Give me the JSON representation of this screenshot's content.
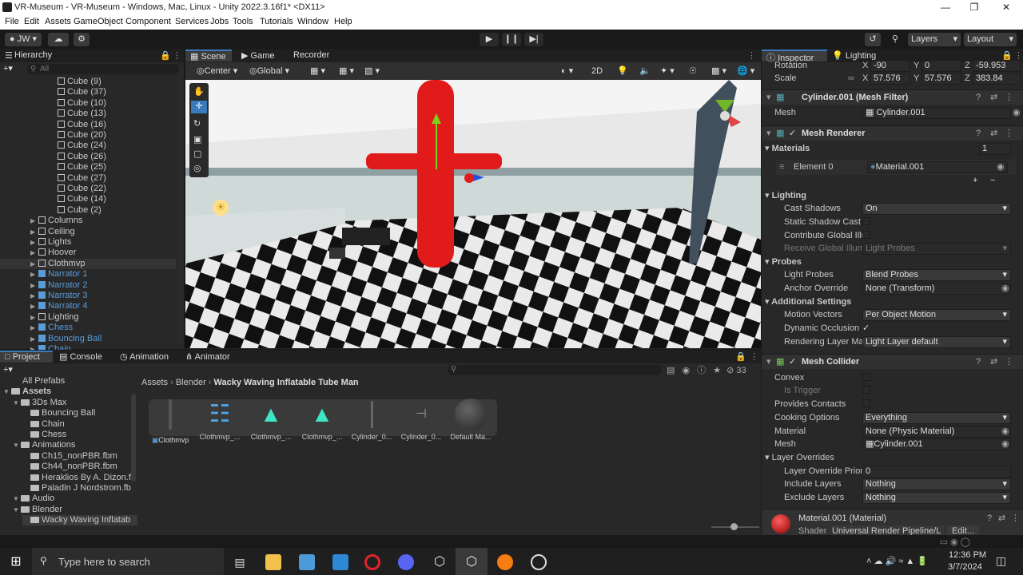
{
  "window": {
    "title": "VR-Museum - VR-Museum - Windows, Mac, Linux - Unity 2022.3.16f1* <DX11>"
  },
  "menu": [
    "File",
    "Edit",
    "Assets",
    "GameObject",
    "Component",
    "Services",
    "Jobs",
    "Tools",
    "Tutorials",
    "Window",
    "Help"
  ],
  "toolbar": {
    "account": "JW",
    "layers": "Layers",
    "layout": "Layout"
  },
  "hierarchy": {
    "tab": "Hierarchy",
    "search_placeholder": "All",
    "items": [
      {
        "label": "Cube (9)",
        "type": "cube"
      },
      {
        "label": "Cube (37)",
        "type": "cube"
      },
      {
        "label": "Cube (10)",
        "type": "cube"
      },
      {
        "label": "Cube (13)",
        "type": "cube"
      },
      {
        "label": "Cube (16)",
        "type": "cube"
      },
      {
        "label": "Cube (20)",
        "type": "cube"
      },
      {
        "label": "Cube (24)",
        "type": "cube"
      },
      {
        "label": "Cube (26)",
        "type": "cube"
      },
      {
        "label": "Cube (25)",
        "type": "cube"
      },
      {
        "label": "Cube (27)",
        "type": "cube"
      },
      {
        "label": "Cube (22)",
        "type": "cube"
      },
      {
        "label": "Cube (14)",
        "type": "cube"
      },
      {
        "label": "Cube (2)",
        "type": "cube"
      },
      {
        "label": "Columns",
        "type": "object"
      },
      {
        "label": "Ceiling",
        "type": "object"
      },
      {
        "label": "Lights",
        "type": "object"
      },
      {
        "label": "Hoover",
        "type": "object"
      },
      {
        "label": "Clothmvp",
        "type": "object"
      },
      {
        "label": "Narrator 1",
        "type": "prefab"
      },
      {
        "label": "Narrator 2",
        "type": "prefab"
      },
      {
        "label": "Narrator 3",
        "type": "prefab"
      },
      {
        "label": "Narrator 4",
        "type": "prefab"
      },
      {
        "label": "Lighting",
        "type": "object"
      },
      {
        "label": "Chess",
        "type": "prefab"
      },
      {
        "label": "Bouncing Ball",
        "type": "prefab"
      },
      {
        "label": "Chain",
        "type": "prefab"
      }
    ]
  },
  "scene": {
    "tabs": [
      "Scene",
      "Game",
      "Recorder"
    ],
    "pivot": "Center",
    "space": "Global",
    "mode_2d": "2D"
  },
  "project": {
    "tabs": [
      "Project",
      "Console",
      "Animation",
      "Animator"
    ],
    "count": "33",
    "breadcrumb": [
      "Assets",
      "Blender",
      "Wacky Waving Inflatable Tube Man"
    ],
    "tree": [
      {
        "label": "All Prefabs",
        "indent": 0
      },
      {
        "label": "Assets",
        "indent": 0
      },
      {
        "label": "3Ds Max",
        "indent": 1
      },
      {
        "label": "Bouncing Ball",
        "indent": 2
      },
      {
        "label": "Chain",
        "indent": 2
      },
      {
        "label": "Chess",
        "indent": 2
      },
      {
        "label": "Animations",
        "indent": 1
      },
      {
        "label": "Ch15_nonPBR.fbm",
        "indent": 2
      },
      {
        "label": "Ch44_nonPBR.fbm",
        "indent": 2
      },
      {
        "label": "Heraklios By A. Dizon.f",
        "indent": 2
      },
      {
        "label": "Paladin J Nordstrom.fb",
        "indent": 2
      },
      {
        "label": "Audio",
        "indent": 1
      },
      {
        "label": "Blender",
        "indent": 1
      },
      {
        "label": "Wacky Waving Inflatab",
        "indent": 2
      }
    ],
    "assets": [
      "Clothmvp",
      "Clothmvp_...",
      "Clothmvp_...",
      "Clothmvp_...",
      "Cylinder_0...",
      "Cylinder_0...",
      "Default Ma..."
    ]
  },
  "inspector": {
    "tabs": [
      "Inspector",
      "Lighting"
    ],
    "rotation": {
      "label": "Rotation",
      "x": "-90",
      "y": "0",
      "z": "-59.953"
    },
    "scale": {
      "label": "Scale",
      "x": "57.576",
      "y": "57.576",
      "z": "383.84"
    },
    "mesh_filter": {
      "title": "Cylinder.001 (Mesh Filter)",
      "mesh_label": "Mesh",
      "mesh_value": "Cylinder.001"
    },
    "mesh_renderer": {
      "title": "Mesh Renderer",
      "materials_label": "Materials",
      "materials_count": "1",
      "element_label": "Element 0",
      "element_value": "Material.001",
      "lighting_label": "Lighting",
      "cast_shadows_label": "Cast Shadows",
      "cast_shadows_value": "On",
      "static_shadow_label": "Static Shadow Cast",
      "contribute_gi_label": "Contribute Global Illu",
      "receive_gi_label": "Receive Global Illum",
      "receive_gi_value": "Light Probes",
      "probes_label": "Probes",
      "light_probes_label": "Light Probes",
      "light_probes_value": "Blend Probes",
      "anchor_label": "Anchor Override",
      "anchor_value": "None (Transform)",
      "additional_label": "Additional Settings",
      "motion_label": "Motion Vectors",
      "motion_value": "Per Object Motion",
      "dynamic_occ_label": "Dynamic Occlusion",
      "rendering_layer_label": "Rendering Layer Ma",
      "rendering_layer_value": "Light Layer default"
    },
    "mesh_collider": {
      "title": "Mesh Collider",
      "convex_label": "Convex",
      "trigger_label": "Is Trigger",
      "contacts_label": "Provides Contacts",
      "cooking_label": "Cooking Options",
      "cooking_value": "Everything",
      "material_label": "Material",
      "material_value": "None (Physic Material)",
      "mesh_label": "Mesh",
      "mesh_value": "Cylinder.001",
      "overrides_label": "Layer Overrides",
      "priority_label": "Layer Override Prior",
      "priority_value": "0",
      "include_label": "Include Layers",
      "include_value": "Nothing",
      "exclude_label": "Exclude Layers",
      "exclude_value": "Nothing"
    },
    "material": {
      "title": "Material.001 (Material)",
      "shader_label": "Shader",
      "shader_value": "Universal Render Pipeline/L",
      "edit": "Edit..."
    }
  },
  "taskbar": {
    "search_placeholder": "Type here to search",
    "time": "12:36 PM",
    "date": "3/7/2024"
  },
  "colors": {
    "accent": "#3a79bb",
    "prefab_text": "#5a9bd8",
    "selected_row": "#2c5d87"
  }
}
